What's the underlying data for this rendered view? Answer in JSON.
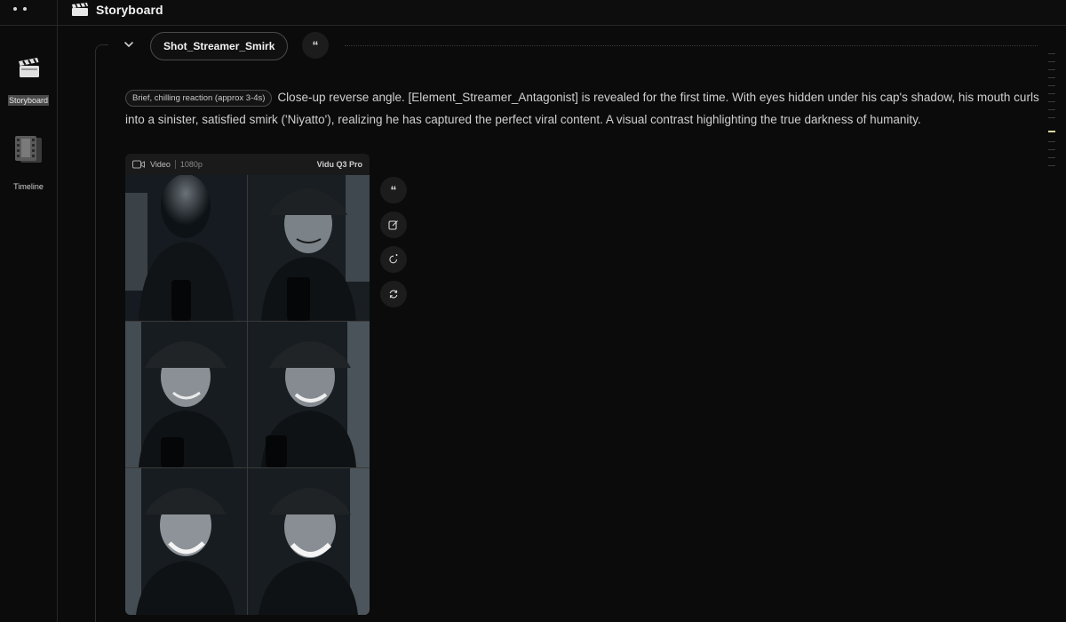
{
  "app": {
    "title": "Storyboard"
  },
  "sidebar": {
    "items": [
      {
        "label": "Storyboard",
        "icon": "clapperboard-icon",
        "active": true
      },
      {
        "label": "Timeline",
        "icon": "film-strip-icon",
        "active": false
      }
    ]
  },
  "shot": {
    "name": "Shot_Streamer_Smirk",
    "quote_glyph": "“",
    "tag": "Brief, chilling reaction (approx 3-4s)",
    "description": "Close-up reverse angle. [Element_Streamer_Antagonist] is revealed for the first time. With eyes hidden under his cap's shadow, his mouth curls into a sinister, satisfied smirk ('Niyatto'), realizing he has captured the perfect viral content. A visual contrast highlighting the true darkness of humanity."
  },
  "video": {
    "type": "Video",
    "resolution": "1080p",
    "model": "Vidu Q3 Pro"
  },
  "actions": [
    {
      "icon": "quote-icon",
      "glyph": "“"
    },
    {
      "icon": "edit-icon"
    },
    {
      "icon": "regenerate-icon"
    },
    {
      "icon": "refresh-icon"
    }
  ],
  "colors": {
    "background": "#0b0b0b",
    "border": "#262626",
    "text": "#cfcfcf",
    "scroll_highlight": "#d9d9a0"
  }
}
